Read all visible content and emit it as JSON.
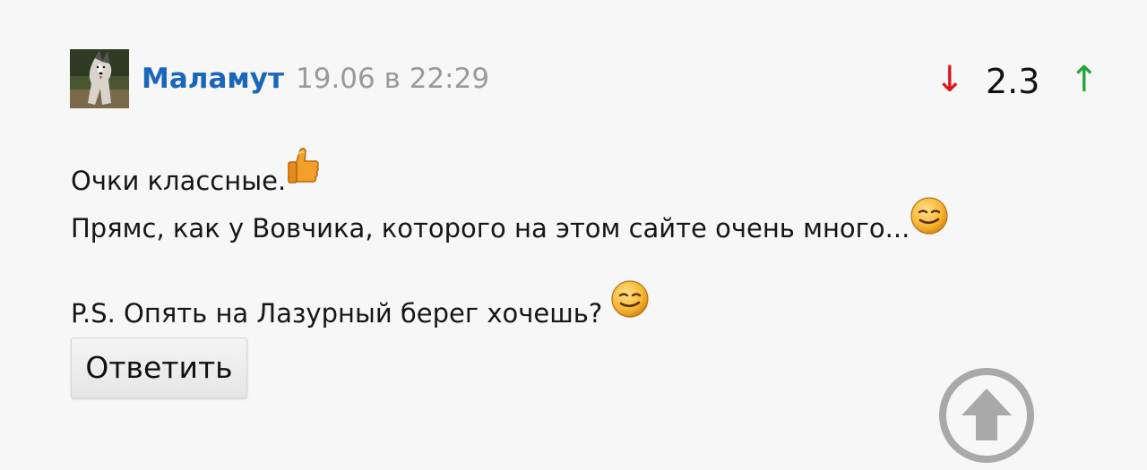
{
  "comment": {
    "author": "Маламут",
    "timestamp": "19.06 в 22:29",
    "rating": "2.3",
    "vote_down": "↓",
    "vote_up": "↑",
    "lines": [
      "Очки классные.",
      "Прямс, как у Вовчика, которого на этом сайте очень много...",
      "P.S. Опять на Лазурный берег хочешь?"
    ],
    "emojis": [
      "thumbs-up-icon",
      "smirk-smiley-icon",
      "smirk-smiley-icon"
    ],
    "reply_label": "Ответить"
  },
  "colors": {
    "author": "#1a66b8",
    "vote_down": "#e0141a",
    "vote_up": "#22a33a",
    "timestamp": "#9a9a9a"
  },
  "icons": {
    "avatar": "husky-avatar",
    "scroll_top": "scroll-to-top-icon"
  }
}
